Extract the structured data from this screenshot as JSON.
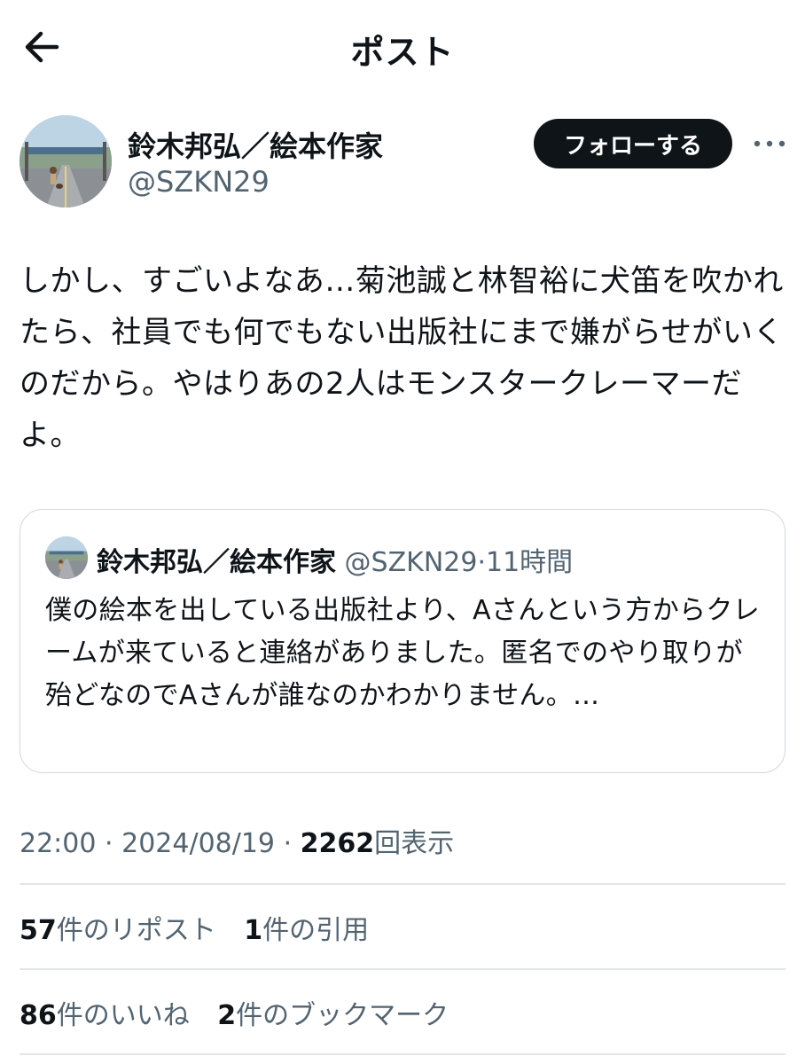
{
  "header": {
    "title": "ポスト",
    "back_icon": "arrow-left-icon"
  },
  "author": {
    "name": "鈴木邦弘／絵本作家",
    "handle": "@SZKN29",
    "follow_label": "フォローする",
    "more_icon": "ellipsis-icon"
  },
  "post": {
    "text": "しかし、すごいよなあ…菊池誠と林智裕に犬笛を吹かれたら、社員でも何でもない出版社にまで嫌がらせがいくのだから。やはりあの2人はモンスタークレーマーだよ。"
  },
  "quote": {
    "name": "鈴木邦弘／絵本作家",
    "handle": "@SZKN29",
    "separator": "·",
    "time": "11時間",
    "text": "僕の絵本を出している出版社より、Aさんという方からクレームが来ていると連絡がありました。匿名でのやり取りが殆どなのでAさんが誰なのかわかりません。…"
  },
  "meta": {
    "time": "22:00",
    "separator": "·",
    "date": "2024/08/19",
    "views": "2262",
    "views_label": "回表示"
  },
  "stats": {
    "reposts": "57",
    "reposts_label": "件のリポスト",
    "quotes": "1",
    "quotes_label": "件の引用",
    "likes": "86",
    "likes_label": "件のいいね",
    "bookmarks": "2",
    "bookmarks_label": "件のブックマーク"
  },
  "colors": {
    "text": "#0f1419",
    "secondary": "#536471",
    "border": "#cfd9de",
    "button_bg": "#0f1419"
  }
}
